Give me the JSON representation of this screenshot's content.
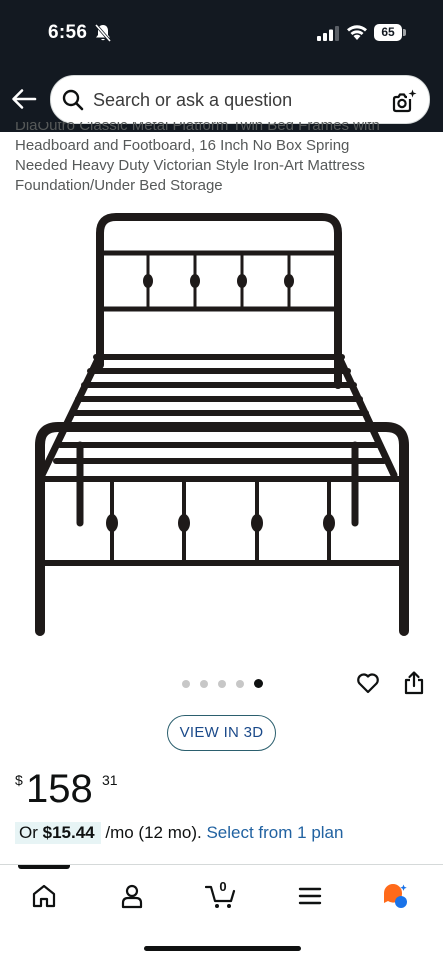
{
  "status_bar": {
    "time": "6:56",
    "battery": "65"
  },
  "header": {
    "search_placeholder": "Search or ask a question"
  },
  "product": {
    "title_cut_line": "DiaOutro Classic Metal Platform Twin Bed Frames with",
    "title_lines": [
      "Headboard and Footboard, 16 Inch No Box Spring",
      "Needed Heavy Duty Victorian Style Iron-Art Mattress",
      "Foundation/Under Bed Storage"
    ],
    "image_count": 5,
    "active_image_index": 4,
    "view_3d_label": "VIEW IN 3D",
    "price": {
      "symbol": "$",
      "whole": "158",
      "fraction": "31"
    },
    "installment": {
      "prefix": "Or",
      "amount": "$15.44",
      "term": "/mo (12 mo).",
      "link": "Select from 1 plan"
    }
  },
  "bottom_nav": {
    "items": [
      "home-icon",
      "account-icon",
      "cart-icon",
      "menu-icon",
      "rufus-icon"
    ],
    "cart_count": "0",
    "active_index": 0
  },
  "colors": {
    "header_bg": "#131921",
    "link": "#2162a1",
    "installment_bg": "#e7f4f5",
    "rufus_orange": "#ff6a1a",
    "rufus_blue": "#1a73e8"
  }
}
